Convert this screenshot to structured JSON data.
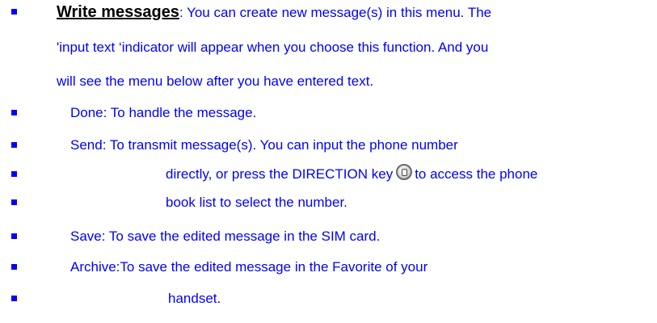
{
  "colors": {
    "body_text": "#0000ff",
    "heading": "#000000",
    "bullet": "#0000ff"
  },
  "intro": {
    "heading": "Write messages",
    "line1": ": You can create new message(s) in this menu. The",
    "line2": "'input text ‘indicator will appear when you choose this function. And you",
    "line3": "will see the menu below after you have entered text."
  },
  "items": {
    "done": "Done: To handle the message.",
    "send_1": "Send: To transmit message(s). You can input the phone number",
    "send_2a": "directly, or press the DIRECTION key",
    "send_2b": "to access the phone",
    "send_3": "book list to select the number.",
    "save": "Save: To save the edited message in the SIM card.",
    "archive_1": "Archive:To save the edited message in the Favorite of your",
    "archive_2": "handset."
  },
  "icons": {
    "direction_key": "direction-key-icon"
  }
}
